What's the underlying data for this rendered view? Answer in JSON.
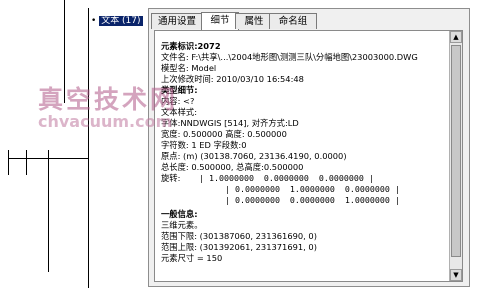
{
  "layer_list": {
    "items": [
      {
        "bullet": "•",
        "label": "文本 (17)"
      }
    ]
  },
  "tabs": [
    {
      "label": "通用设置",
      "active": false
    },
    {
      "label": "细节",
      "active": true
    },
    {
      "label": "属性",
      "active": false
    },
    {
      "label": "命名组",
      "active": false
    }
  ],
  "details": {
    "element_id": "元素标识:2072",
    "file_name": "文件名: F:\\共享\\...\\2004地形图\\测测三队\\分幅地图\\23003000.DWG",
    "model_name": "模型名: Model",
    "last_modified": "上次修改时间: 2010/03/10 16:54:48",
    "type_detail_heading": "类型细节:",
    "content": "内容: <?",
    "text_style": "文本样式:",
    "font": "字体:NNDWGIS [514], 对齐方式:LD",
    "width_height": "宽度: 0.500000 高度: 0.500000",
    "char_count": "字符数: 1 ED 字段数:0",
    "origin": "原点: (m) (30138.7060, 23136.4190, 0.0000)",
    "total": "总长度: 0.500000, 总高度:0.500000",
    "rotation_label": "旋转:",
    "rotation_rows": [
      "| 1.0000000  0.0000000  0.0000000 |",
      "| 0.0000000  1.0000000  0.0000000 |",
      "| 0.0000000  0.0000000  1.0000000 |"
    ],
    "general_heading": "一般信息:",
    "general_3d": "三维元素。",
    "range_low": "范围下限: (301387060, 231361690, 0)",
    "range_high": "范围上限: (301392061, 231371691, 0)",
    "element_size": "元素尺寸 = 150"
  },
  "watermark": {
    "cn": "真空技术网",
    "en": "chvacuum.com"
  },
  "colors": {
    "selection": "#0a246a",
    "watermark": "#b25a8a",
    "panel": "#f0f0f0"
  }
}
